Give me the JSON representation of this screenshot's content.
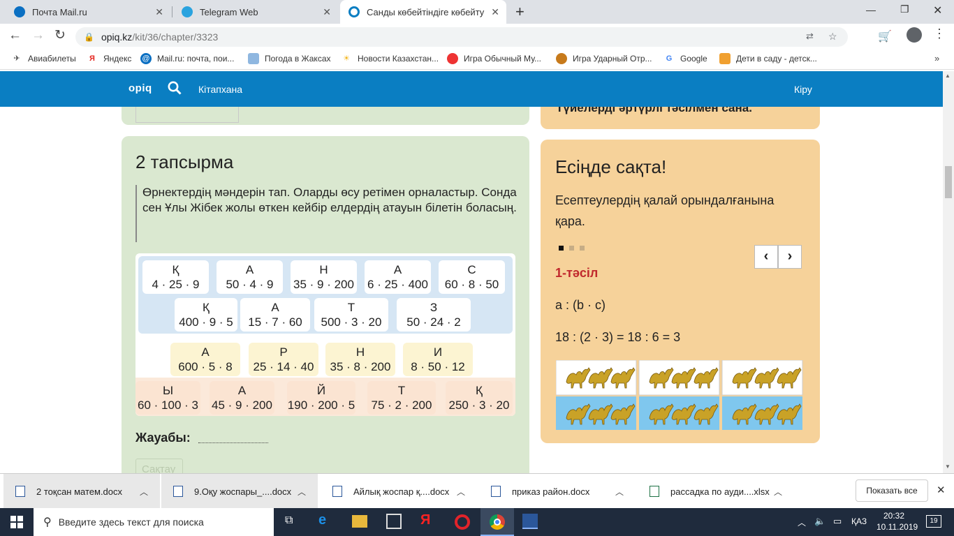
{
  "tabs": [
    {
      "title": "Почта Mail.ru",
      "active": false
    },
    {
      "title": "Telegram Web",
      "active": false
    },
    {
      "title": "Санды көбейтіндіге көбейту жә",
      "active": true
    }
  ],
  "address": {
    "domain": "opiq.kz",
    "path": "/kit/36/chapter/3323"
  },
  "bookmarks": [
    "Авиабилеты",
    "Яндекс",
    "Mail.ru: почта, пои...",
    "Погода в Жаксах",
    "Новости Казахстан...",
    "Игра Обычный Му...",
    "Игра Ударный Отр...",
    "Google",
    "Дети в саду - детск..."
  ],
  "site": {
    "logo": "opiq",
    "library": "Кітапхана",
    "login": "Кіру"
  },
  "top_right_text": "Түйелерді әртүрлі тәсілмен сана.",
  "task": {
    "title": "2 тапсырма",
    "instruction": "Өрнектердің мәндерін тап. Оларды өсу ретімен орналастыр. Сонда сен Ұлы Жібек жолы өткен кейбір елдердің атауын білетін боласың.",
    "rows": [
      [
        {
          "letter": "Қ",
          "expr": "4 · 25 · 9"
        },
        {
          "letter": "А",
          "expr": "50 · 4 · 9"
        },
        {
          "letter": "Н",
          "expr": "35 · 9 · 200"
        },
        {
          "letter": "А",
          "expr": "6 · 25 · 400"
        },
        {
          "letter": "С",
          "expr": "60 · 8 · 50"
        }
      ],
      [
        {
          "letter": "Қ",
          "expr": "400 · 9 · 5"
        },
        {
          "letter": "А",
          "expr": "15 · 7 · 60"
        },
        {
          "letter": "Т",
          "expr": "500 · 3 · 20"
        },
        {
          "letter": "З",
          "expr": "50 · 24 · 2"
        }
      ],
      [
        {
          "letter": "А",
          "expr": "600 · 5 · 8"
        },
        {
          "letter": "Р",
          "expr": "25 · 14 · 40"
        },
        {
          "letter": "Н",
          "expr": "35 · 8 · 200"
        },
        {
          "letter": "И",
          "expr": "8 · 50 · 12"
        }
      ],
      [
        {
          "letter": "Ы",
          "expr": "60 · 100 · 3"
        },
        {
          "letter": "А",
          "expr": "45 · 9 · 200"
        },
        {
          "letter": "Й",
          "expr": "190 · 200 · 5"
        },
        {
          "letter": "Т",
          "expr": "75 · 2 · 200"
        },
        {
          "letter": "Қ",
          "expr": "250 · 3 · 20"
        }
      ]
    ],
    "answer_label": "Жауабы:",
    "save_label": "Сақтау"
  },
  "remember": {
    "title": "Есіңде сақта!",
    "text": "Есептеулердің қалай орындалғанына қара.",
    "method": "1-тәсіл",
    "formula": "a : (b · c)",
    "example": "18 : (2 · 3) = 18 : 6 = 3"
  },
  "downloads": [
    "2 тоқсан матем.docx",
    "9.Оқу жоспары_....docx",
    "Айлық жоспар қ....docx",
    "приказ район.docx",
    "рассадка по  ауди....xlsx"
  ],
  "downloads_show_all": "Показать все",
  "taskbar": {
    "search_placeholder": "Введите здесь текст для поиска",
    "lang": "ҚАЗ",
    "time": "20:32",
    "date": "10.11.2019",
    "notif_count": "19"
  },
  "colors": {
    "accent": "#0a7ec2",
    "method": "#c0282d",
    "green_panel": "#dae8d0",
    "peach_panel": "#f6d29a"
  }
}
